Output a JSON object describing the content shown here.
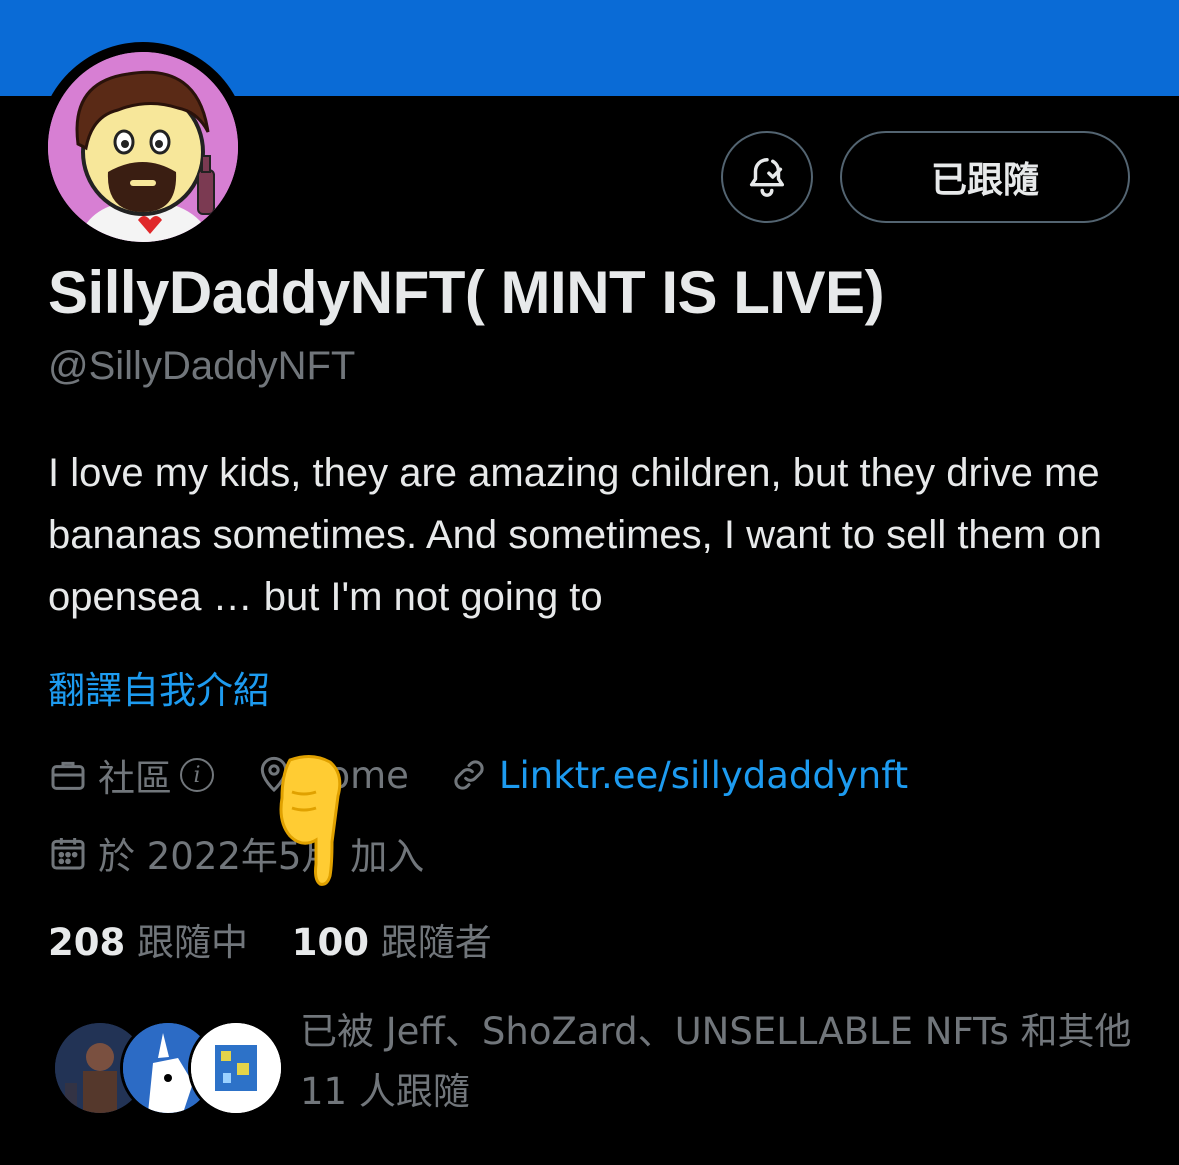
{
  "profile": {
    "display_name": "SillyDaddyNFT( MINT IS LIVE)",
    "handle": "@SillyDaddyNFT",
    "bio": "I love my kids, they are amazing children, but they drive me bananas sometimes. And sometimes, I want to sell them on opensea … but I'm not going to",
    "translate_label": "翻譯自我介紹",
    "category": "社區",
    "location": "home",
    "link": "Linktr.ee/sillydaddynft",
    "joined": "於 2022年5月 加入"
  },
  "actions": {
    "follow_label": "已跟隨",
    "notification_icon": "bell-check-icon"
  },
  "stats": {
    "following_count": "208",
    "following_label": "跟隨中",
    "followers_count": "100",
    "followers_label": "跟隨者"
  },
  "followed_by": {
    "text": "已被 Jeff、ShoZard、UNSELLABLE NFTs 和其他 11 人跟隨"
  },
  "colors": {
    "banner": "#0a6bd6",
    "accent": "#1d9bf0",
    "muted": "#71767b",
    "text": "#e7e9ea",
    "background": "#000000"
  }
}
